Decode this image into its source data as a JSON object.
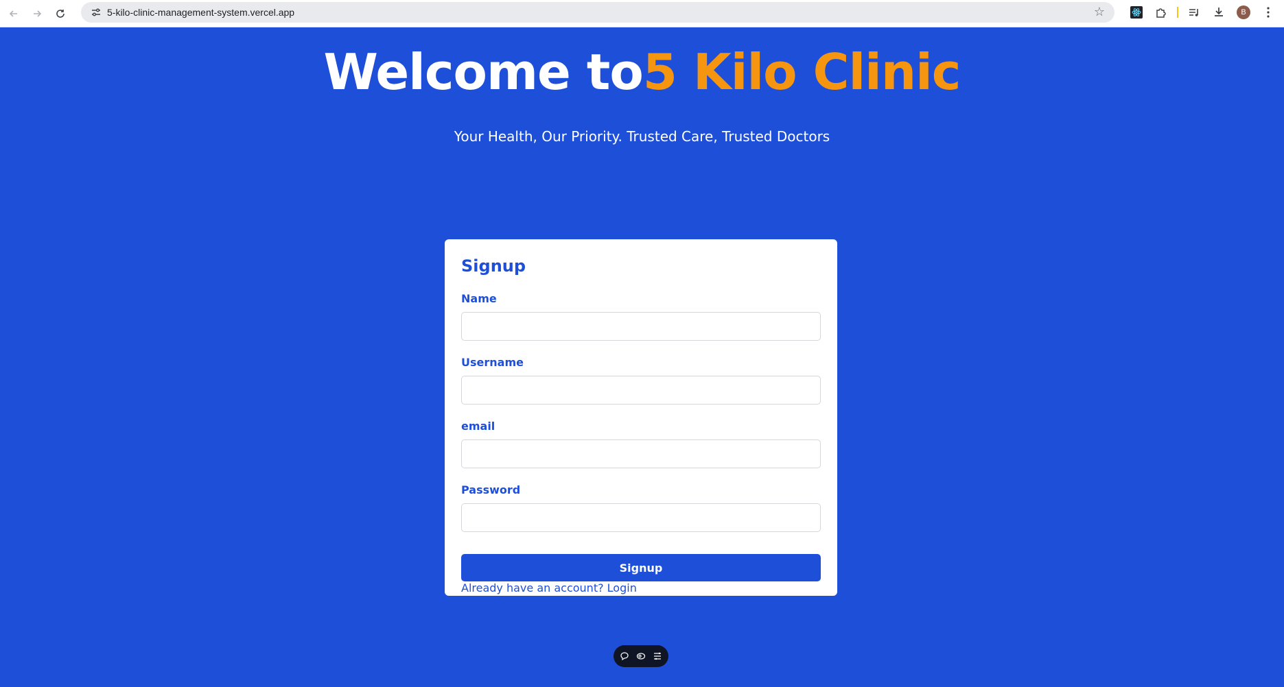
{
  "browser": {
    "url": "5-kilo-clinic-management-system.vercel.app",
    "avatar_initial": "B"
  },
  "hero": {
    "title_prefix": "Welcome to",
    "title_accent": "5 Kilo Clinic",
    "subtitle": "Your Health, Our Priority. Trusted Care, Trusted Doctors"
  },
  "form": {
    "title": "Signup",
    "fields": [
      {
        "label": "Name",
        "value": ""
      },
      {
        "label": "Username",
        "value": ""
      },
      {
        "label": "email",
        "value": ""
      },
      {
        "label": "Password",
        "value": ""
      }
    ],
    "submit_label": "Signup",
    "login_link": "Already have an account? Login"
  },
  "colors": {
    "background": "#1e4fd8",
    "accent": "#f6950f",
    "card": "#ffffff"
  }
}
